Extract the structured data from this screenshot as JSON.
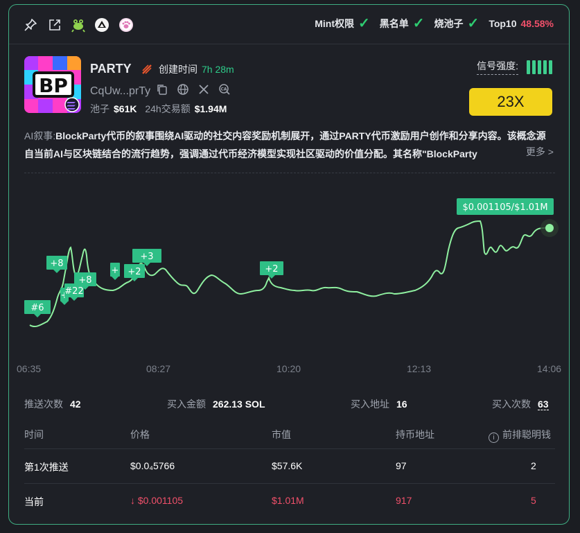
{
  "header": {
    "checks": [
      {
        "label": "Mint权限"
      },
      {
        "label": "黑名单"
      },
      {
        "label": "烧池子"
      }
    ],
    "top10_label": "Top10",
    "top10_value": "48.58%"
  },
  "token": {
    "logo_text": "BP",
    "name": "PARTY",
    "created_label": "创建时间",
    "created_value": "7h 28m",
    "address": "CqUw...prTy",
    "pool_label": "池子",
    "pool_value": "$61K",
    "volume_label": "24h交易额",
    "volume_value": "$1.94M",
    "signal_label": "信号强度:",
    "signal_bars": 5,
    "multiplier": "23X"
  },
  "narrative": {
    "label": "AI叙事:",
    "text": "BlockParty代币的叙事围绕AI驱动的社交内容奖励机制展开，通过PARTY代币激励用户创作和分享内容。该概念源自当前AI与区块链结合的流行趋势，强调通过代币经济模型实现社区驱动的价值分配。其名称\"BlockParty",
    "more": "更多 >"
  },
  "chart": {
    "current_label": "$0.001105/$1.01M",
    "line_color": "#8ff0a0",
    "tag_color": "#2fbf86",
    "tags": [
      "#6",
      "+8",
      "+",
      "#22",
      "+8",
      "+",
      "+2",
      "+3",
      "+2"
    ],
    "x_ticks": [
      "06:35",
      "08:27",
      "10:20",
      "12:13",
      "14:06"
    ]
  },
  "metrics": {
    "push_label": "推送次数",
    "push_value": "42",
    "buy_amount_label": "买入金额",
    "buy_amount_value": "262.13 SOL",
    "buy_addr_label": "买入地址",
    "buy_addr_value": "16",
    "buy_count_label": "买入次数",
    "buy_count_value": "63"
  },
  "table": {
    "headers": [
      "时间",
      "价格",
      "市值",
      "持币地址",
      "前排聪明钱"
    ],
    "rows": [
      {
        "time": "第1次推送",
        "price": "$0.0₄5766",
        "mcap": "$57.6K",
        "holders": "97",
        "smart": "2"
      },
      {
        "time": "当前",
        "price": "↓ $0.001105",
        "mcap": "$1.01M",
        "holders": "917",
        "smart": "5"
      }
    ]
  }
}
